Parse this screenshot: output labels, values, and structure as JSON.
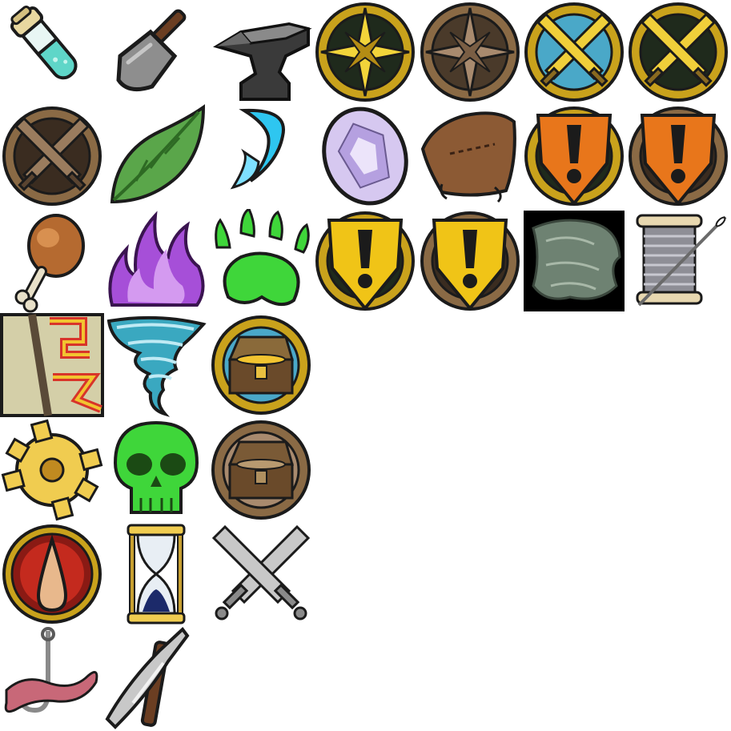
{
  "sheet": {
    "background": "#ffffff",
    "columns": 7,
    "rows": 7
  },
  "icons": [
    {
      "name": "potion-vial-icon",
      "row": 0,
      "col": 0
    },
    {
      "name": "shovel-icon",
      "row": 0,
      "col": 1
    },
    {
      "name": "anvil-icon",
      "row": 0,
      "col": 2
    },
    {
      "name": "compass-rose-gold-icon",
      "row": 0,
      "col": 3
    },
    {
      "name": "compass-rose-bronze-icon",
      "row": 0,
      "col": 4
    },
    {
      "name": "crossed-swords-blue-icon",
      "row": 0,
      "col": 5
    },
    {
      "name": "crossed-swords-dark-icon",
      "row": 0,
      "col": 6
    },
    {
      "name": "crossed-swords-bronze-icon",
      "row": 1,
      "col": 0
    },
    {
      "name": "leaf-icon",
      "row": 1,
      "col": 1
    },
    {
      "name": "water-wisp-icon",
      "row": 1,
      "col": 2
    },
    {
      "name": "gem-icon",
      "row": 1,
      "col": 3
    },
    {
      "name": "leather-icon",
      "row": 1,
      "col": 4
    },
    {
      "name": "quest-alert-orange-icon",
      "row": 1,
      "col": 5
    },
    {
      "name": "quest-alert-orange-bronze-icon",
      "row": 1,
      "col": 6
    },
    {
      "name": "meat-drumstick-icon",
      "row": 2,
      "col": 0
    },
    {
      "name": "purple-flame-icon",
      "row": 2,
      "col": 1
    },
    {
      "name": "paw-print-icon",
      "row": 2,
      "col": 2
    },
    {
      "name": "quest-alert-yellow-icon",
      "row": 2,
      "col": 3
    },
    {
      "name": "quest-alert-yellow-bronze-icon",
      "row": 2,
      "col": 4
    },
    {
      "name": "fur-pelt-icon",
      "row": 2,
      "col": 5
    },
    {
      "name": "thread-spool-icon",
      "row": 2,
      "col": 6
    },
    {
      "name": "rune-stone-icon",
      "row": 3,
      "col": 0
    },
    {
      "name": "tornado-icon",
      "row": 3,
      "col": 1
    },
    {
      "name": "treasure-chest-blue-icon",
      "row": 3,
      "col": 2
    },
    {
      "name": "gear-icon",
      "row": 4,
      "col": 0
    },
    {
      "name": "poison-skull-icon",
      "row": 4,
      "col": 1
    },
    {
      "name": "treasure-chest-bronze-icon",
      "row": 4,
      "col": 2
    },
    {
      "name": "blood-drop-icon",
      "row": 5,
      "col": 0
    },
    {
      "name": "hourglass-icon",
      "row": 5,
      "col": 1
    },
    {
      "name": "crossed-swords-steel-icon",
      "row": 5,
      "col": 2
    },
    {
      "name": "fishing-hook-worm-icon",
      "row": 6,
      "col": 0
    },
    {
      "name": "pickaxe-icon",
      "row": 6,
      "col": 1
    }
  ],
  "colors": {
    "gold_rim": "#c9a21c",
    "bronze_rim": "#8a6a45",
    "dark_center": "#1f2a1c",
    "blue_center": "#4aa8c8",
    "orange_alert": "#e8761b",
    "yellow_alert": "#f0c417",
    "poison_green": "#3fd63a",
    "purple_flame": "#a64fd8",
    "water_cyan": "#2ec6f0",
    "tornado_teal": "#3aa8c0"
  }
}
